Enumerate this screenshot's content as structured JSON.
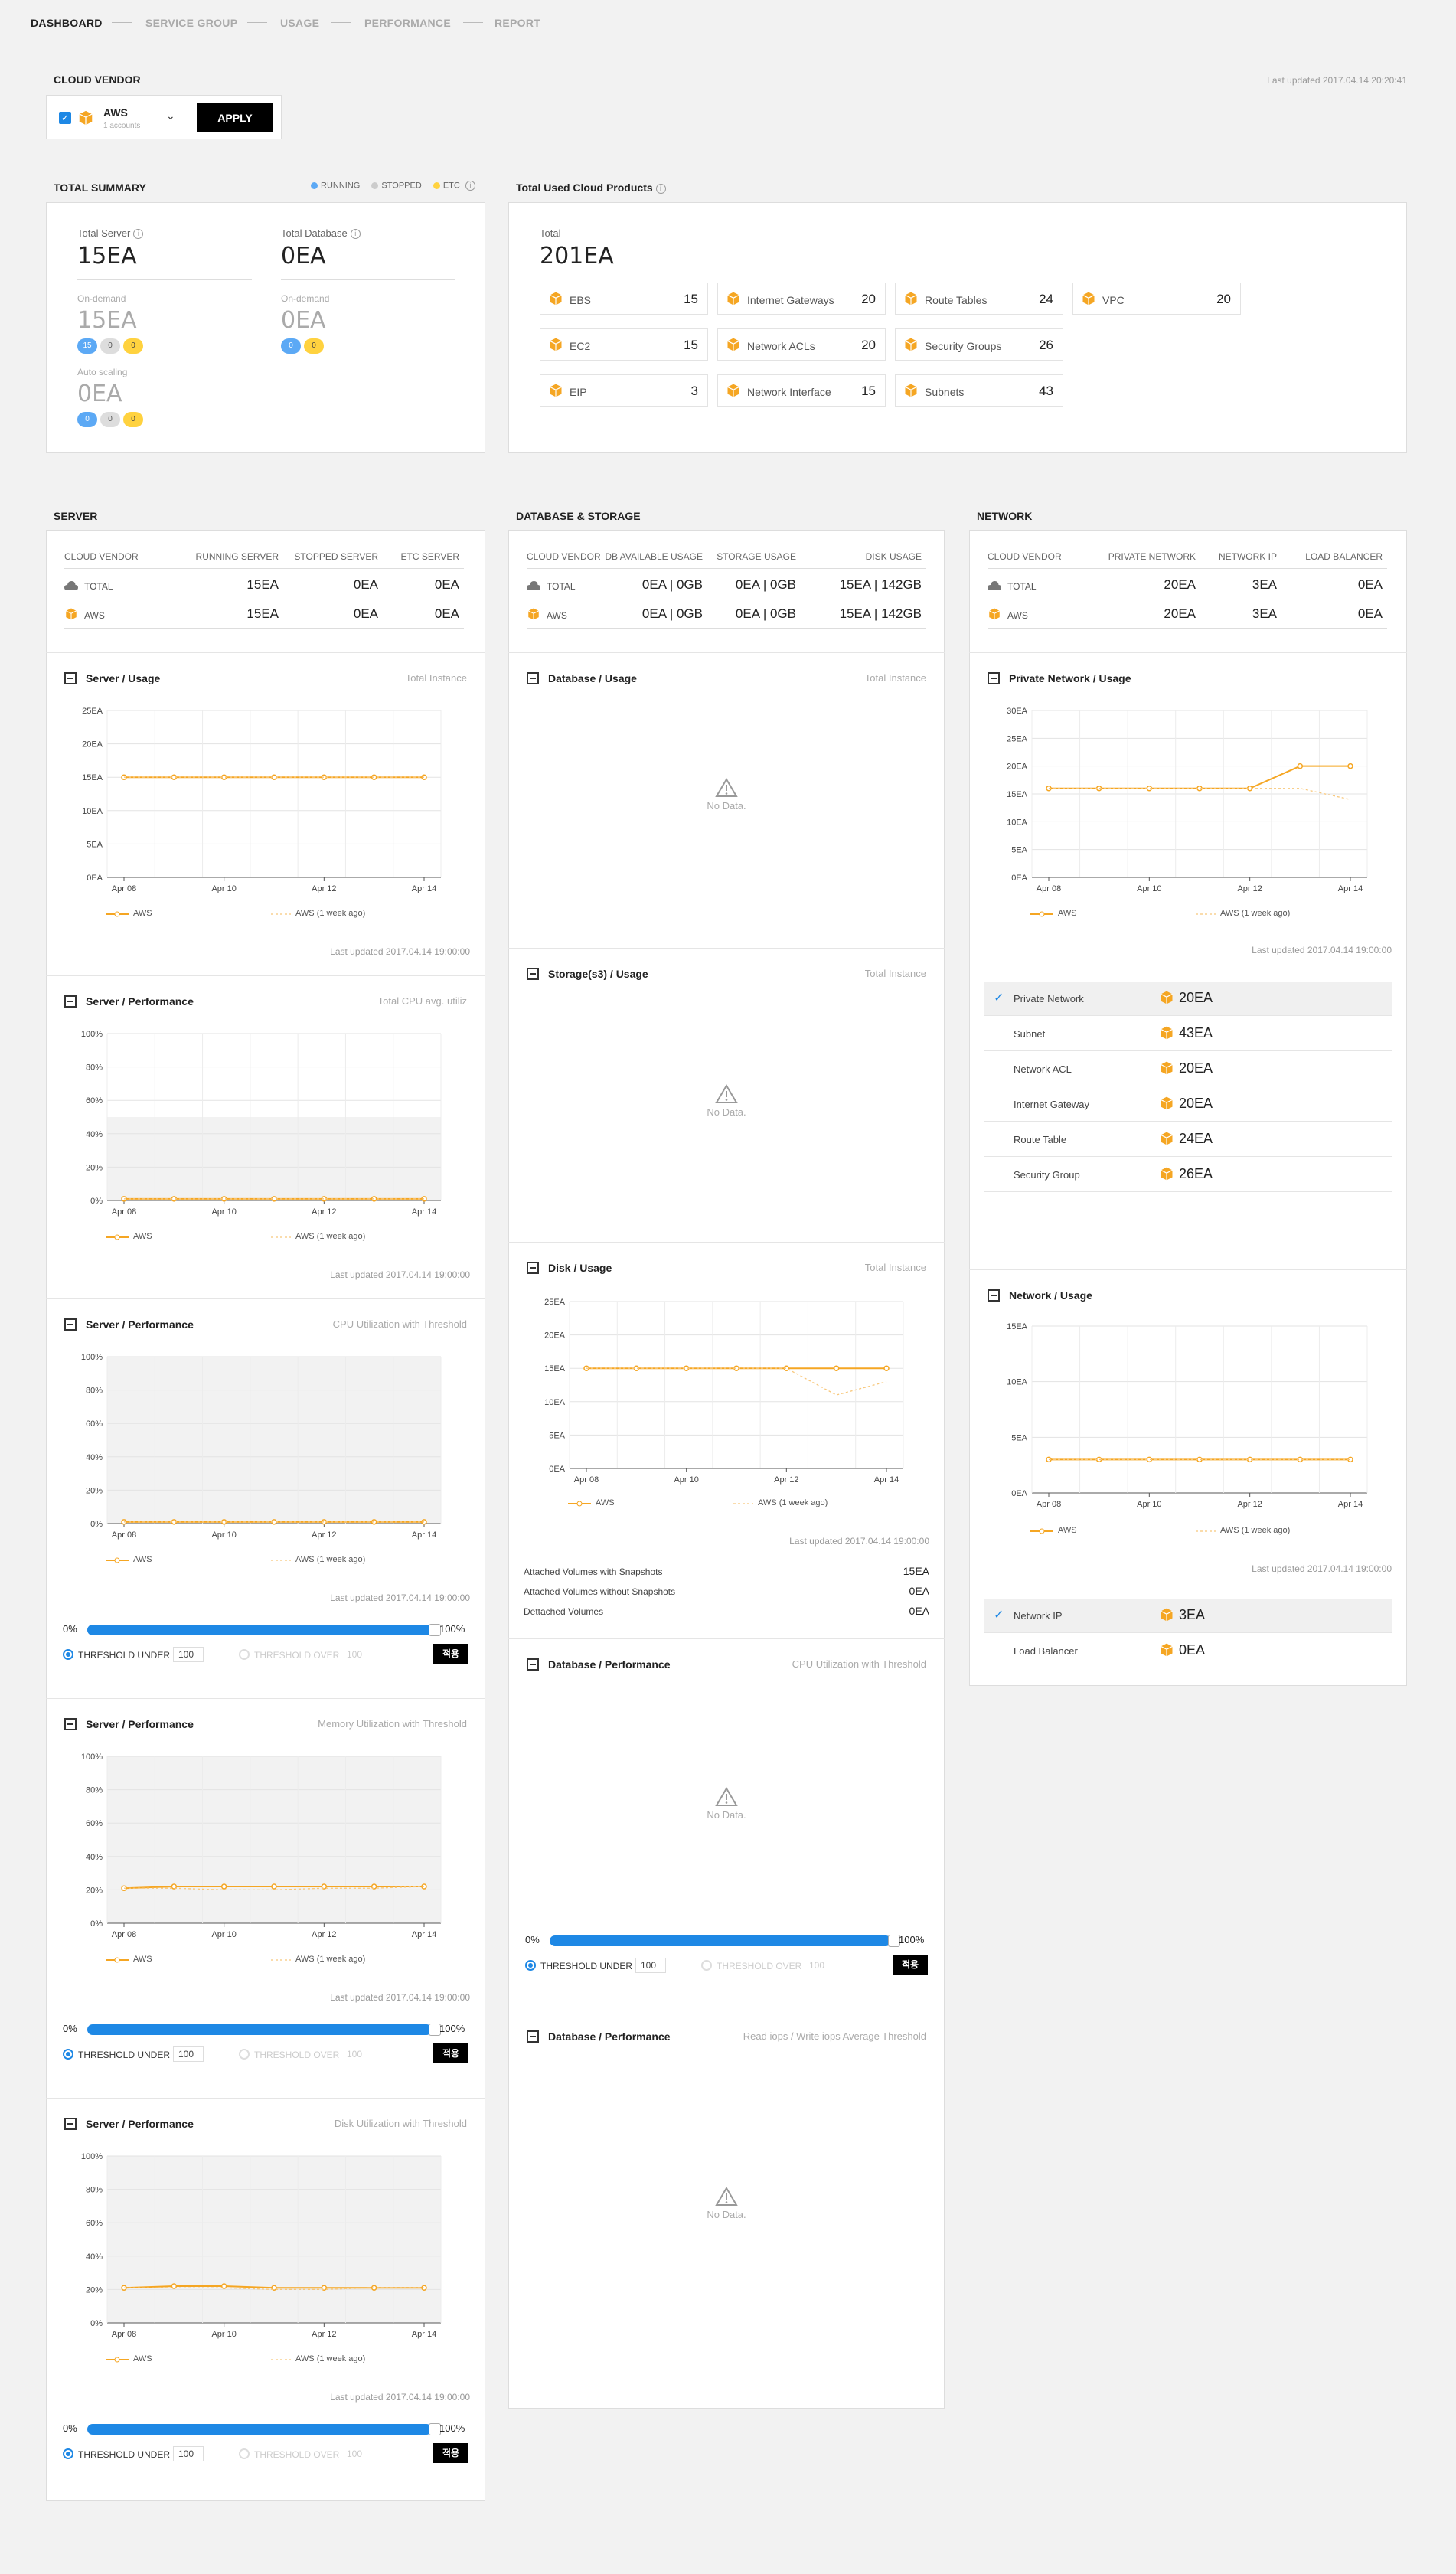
{
  "nav": {
    "tabs": [
      {
        "label": "DASHBOARD",
        "active": true
      },
      {
        "label": "SERVICE GROUP",
        "active": false
      },
      {
        "label": "USAGE",
        "active": false
      },
      {
        "label": "PERFORMANCE",
        "active": false
      },
      {
        "label": "REPORT",
        "active": false
      }
    ]
  },
  "vendor": {
    "title": "CLOUD VENDOR",
    "name": "AWS",
    "accounts": "1 accounts",
    "apply": "APPLY",
    "last_updated": "Last updated 2017.04.14 20:20:41"
  },
  "summary": {
    "title": "TOTAL SUMMARY",
    "legend": [
      "RUNNING",
      "STOPPED",
      "ETC"
    ],
    "legend_colors": [
      "#5ca9f5",
      "#cccccc",
      "#ffd23f"
    ],
    "total_server_label": "Total Server",
    "total_server": "15EA",
    "total_db_label": "Total Database",
    "total_db": "0EA",
    "server_ondemand_label": "On-demand",
    "server_ondemand": "15EA",
    "server_ondemand_pills": [
      "15",
      "0",
      "0"
    ],
    "db_ondemand_label": "On-demand",
    "db_ondemand": "0EA",
    "db_ondemand_pills": [
      "0",
      "0"
    ],
    "autoscaling_label": "Auto scaling",
    "autoscaling": "0EA",
    "autoscaling_pills": [
      "0",
      "0",
      "0"
    ]
  },
  "products": {
    "title": "Total Used Cloud Products",
    "total_label": "Total",
    "total": "201EA",
    "items": [
      {
        "name": "EBS",
        "count": "15"
      },
      {
        "name": "Internet Gateways",
        "count": "20"
      },
      {
        "name": "Route Tables",
        "count": "24"
      },
      {
        "name": "VPC",
        "count": "20"
      },
      {
        "name": "EC2",
        "count": "15"
      },
      {
        "name": "Network ACLs",
        "count": "20"
      },
      {
        "name": "Security Groups",
        "count": "26"
      },
      {
        "name": "EIP",
        "count": "3"
      },
      {
        "name": "Network Interface",
        "count": "15"
      },
      {
        "name": "Subnets",
        "count": "43"
      }
    ]
  },
  "server": {
    "title": "SERVER",
    "headers": [
      "CLOUD VENDOR",
      "RUNNING SERVER",
      "STOPPED SERVER",
      "ETC SERVER"
    ],
    "rows": [
      {
        "name": "TOTAL",
        "cells": [
          "15EA",
          "0EA",
          "0EA"
        ]
      },
      {
        "name": "AWS",
        "cells": [
          "15EA",
          "0EA",
          "0EA"
        ]
      }
    ]
  },
  "dbs": {
    "title": "DATABASE & STORAGE",
    "headers": [
      "CLOUD VENDOR",
      "DB AVAILABLE USAGE",
      "STORAGE USAGE",
      "DISK USAGE"
    ],
    "rows": [
      {
        "name": "TOTAL",
        "cells": [
          "0EA | 0GB",
          "0EA | 0GB",
          "15EA | 142GB"
        ]
      },
      {
        "name": "AWS",
        "cells": [
          "0EA | 0GB",
          "0EA | 0GB",
          "15EA | 142GB"
        ]
      }
    ]
  },
  "network": {
    "title": "NETWORK",
    "headers": [
      "CLOUD VENDOR",
      "PRIVATE NETWORK",
      "NETWORK IP",
      "LOAD BALANCER"
    ],
    "rows": [
      {
        "name": "TOTAL",
        "cells": [
          "20EA",
          "3EA",
          "0EA"
        ]
      },
      {
        "name": "AWS",
        "cells": [
          "20EA",
          "3EA",
          "0EA"
        ]
      }
    ],
    "private_items": [
      {
        "name": "Private Network",
        "value": "20EA",
        "checked": true
      },
      {
        "name": "Subnet",
        "value": "43EA",
        "checked": false
      },
      {
        "name": "Network ACL",
        "value": "20EA",
        "checked": false
      },
      {
        "name": "Internet Gateway",
        "value": "20EA",
        "checked": false
      },
      {
        "name": "Route Table",
        "value": "24EA",
        "checked": false
      },
      {
        "name": "Security Group",
        "value": "26EA",
        "checked": false
      }
    ],
    "ip_items": [
      {
        "name": "Network IP",
        "value": "3EA",
        "checked": true
      },
      {
        "name": "Load Balancer",
        "value": "0EA",
        "checked": false
      }
    ]
  },
  "common": {
    "last_updated": "Last updated 2017.04.14 19:00:00",
    "legend_a": "AWS",
    "legend_b": "AWS (1 week ago)",
    "no_data": "No Data.",
    "bar_min": "0%",
    "bar_max": "100%",
    "thr_under": "THRESHOLD UNDER",
    "thr_over": "THRESHOLD OVER",
    "thr_value": "100",
    "thr_apply": "적용"
  },
  "disk_extra": [
    {
      "label": "Attached Volumes with Snapshots",
      "value": "15EA"
    },
    {
      "label": "Attached Volumes without Snapshots",
      "value": "0EA"
    },
    {
      "label": "Dettached Volumes",
      "value": "0EA"
    }
  ],
  "chart_data": [
    {
      "id": "server-usage",
      "type": "line",
      "title": "Server / Usage",
      "subtitle": "Total Instance",
      "x": [
        "Apr 08",
        "Apr 09",
        "Apr 10",
        "Apr 11",
        "Apr 12",
        "Apr 13",
        "Apr 14"
      ],
      "yticks": [
        "0EA",
        "5EA",
        "10EA",
        "15EA",
        "20EA",
        "25EA"
      ],
      "ylim": [
        0,
        25
      ],
      "series": [
        {
          "name": "AWS",
          "values": [
            15,
            15,
            15,
            15,
            15,
            15,
            15
          ]
        },
        {
          "name": "AWS (1 week ago)",
          "values": [
            15,
            15,
            15,
            15,
            15,
            15,
            15
          ]
        }
      ]
    },
    {
      "id": "server-cpu",
      "type": "line",
      "title": "Server / Performance",
      "subtitle": "Total CPU avg. utiliz",
      "x": [
        "Apr 08",
        "Apr 09",
        "Apr 10",
        "Apr 11",
        "Apr 12",
        "Apr 13",
        "Apr 14"
      ],
      "yticks": [
        "0%",
        "20%",
        "40%",
        "60%",
        "80%",
        "100%"
      ],
      "ylim": [
        0,
        100
      ],
      "shade_below": 50,
      "series": [
        {
          "name": "AWS",
          "values": [
            1,
            1,
            1,
            1,
            1,
            1,
            1
          ]
        },
        {
          "name": "AWS (1 week ago)",
          "values": [
            1,
            1,
            1,
            1,
            1,
            1,
            1
          ]
        }
      ]
    },
    {
      "id": "server-cpu-thr",
      "type": "line",
      "title": "Server / Performance",
      "subtitle": "CPU Utilization with Threshold",
      "x": [
        "Apr 08",
        "Apr 09",
        "Apr 10",
        "Apr 11",
        "Apr 12",
        "Apr 13",
        "Apr 14"
      ],
      "yticks": [
        "0%",
        "20%",
        "40%",
        "60%",
        "80%",
        "100%"
      ],
      "ylim": [
        0,
        100
      ],
      "shade_below": 100,
      "series": [
        {
          "name": "AWS",
          "values": [
            1,
            1,
            1,
            1,
            1,
            1,
            1
          ]
        },
        {
          "name": "AWS (1 week ago)",
          "values": [
            1,
            1,
            1,
            1,
            1,
            1,
            1
          ]
        }
      ]
    },
    {
      "id": "server-mem-thr",
      "type": "line",
      "title": "Server / Performance",
      "subtitle": "Memory Utilization with Threshold",
      "x": [
        "Apr 08",
        "Apr 09",
        "Apr 10",
        "Apr 11",
        "Apr 12",
        "Apr 13",
        "Apr 14"
      ],
      "yticks": [
        "0%",
        "20%",
        "40%",
        "60%",
        "80%",
        "100%"
      ],
      "ylim": [
        0,
        100
      ],
      "shade_below": 100,
      "series": [
        {
          "name": "AWS",
          "values": [
            21,
            22,
            22,
            22,
            22,
            22,
            22
          ]
        },
        {
          "name": "AWS (1 week ago)",
          "values": [
            21,
            21,
            20,
            20,
            21,
            21,
            22
          ]
        }
      ]
    },
    {
      "id": "server-disk-thr",
      "type": "line",
      "title": "Server / Performance",
      "subtitle": "Disk Utilization with Threshold",
      "x": [
        "Apr 08",
        "Apr 09",
        "Apr 10",
        "Apr 11",
        "Apr 12",
        "Apr 13",
        "Apr 14"
      ],
      "yticks": [
        "0%",
        "20%",
        "40%",
        "60%",
        "80%",
        "100%"
      ],
      "ylim": [
        0,
        100
      ],
      "shade_below": 100,
      "series": [
        {
          "name": "AWS",
          "values": [
            21,
            22,
            22,
            21,
            21,
            21,
            21
          ]
        },
        {
          "name": "AWS (1 week ago)",
          "values": [
            21,
            21,
            21,
            20,
            20,
            21,
            21
          ]
        }
      ]
    },
    {
      "id": "disk-usage",
      "type": "line",
      "title": "Disk / Usage",
      "subtitle": "Total Instance",
      "x": [
        "Apr 08",
        "Apr 09",
        "Apr 10",
        "Apr 11",
        "Apr 12",
        "Apr 13",
        "Apr 14"
      ],
      "yticks": [
        "0EA",
        "5EA",
        "10EA",
        "15EA",
        "20EA",
        "25EA"
      ],
      "ylim": [
        0,
        25
      ],
      "series": [
        {
          "name": "AWS",
          "values": [
            15,
            15,
            15,
            15,
            15,
            15,
            15
          ]
        },
        {
          "name": "AWS (1 week ago)",
          "values": [
            15,
            15,
            15,
            15,
            15,
            11,
            13
          ]
        }
      ]
    },
    {
      "id": "private-net-usage",
      "type": "line",
      "title": "Private Network / Usage",
      "subtitle": "",
      "x": [
        "Apr 08",
        "Apr 09",
        "Apr 10",
        "Apr 11",
        "Apr 12",
        "Apr 13",
        "Apr 14"
      ],
      "yticks": [
        "0EA",
        "5EA",
        "10EA",
        "15EA",
        "20EA",
        "25EA",
        "30EA"
      ],
      "ylim": [
        0,
        30
      ],
      "series": [
        {
          "name": "AWS",
          "values": [
            16,
            16,
            16,
            16,
            16,
            20,
            20
          ]
        },
        {
          "name": "AWS (1 week ago)",
          "values": [
            16,
            16,
            16,
            16,
            16,
            16,
            14
          ]
        }
      ]
    },
    {
      "id": "network-usage",
      "type": "line",
      "title": "Network / Usage",
      "subtitle": "",
      "x": [
        "Apr 08",
        "Apr 09",
        "Apr 10",
        "Apr 11",
        "Apr 12",
        "Apr 13",
        "Apr 14"
      ],
      "yticks": [
        "0EA",
        "5EA",
        "10EA",
        "15EA"
      ],
      "ylim": [
        0,
        15
      ],
      "series": [
        {
          "name": "AWS",
          "values": [
            3,
            3,
            3,
            3,
            3,
            3,
            3
          ]
        },
        {
          "name": "AWS (1 week ago)",
          "values": [
            3,
            3,
            3,
            3,
            3,
            3,
            3
          ]
        }
      ]
    }
  ],
  "empty_panels": [
    {
      "id": "db-usage",
      "title": "Database / Usage",
      "subtitle": "Total Instance"
    },
    {
      "id": "storage-usage",
      "title": "Storage(s3) / Usage",
      "subtitle": "Total Instance"
    },
    {
      "id": "db-cpu",
      "title": "Database / Performance",
      "subtitle": "CPU Utilization with Threshold"
    },
    {
      "id": "db-iops",
      "title": "Database / Performance",
      "subtitle": "Read iops / Write iops Average Threshold"
    }
  ],
  "colors": {
    "accent": "#f5a623",
    "blue": "#1e88e5"
  }
}
